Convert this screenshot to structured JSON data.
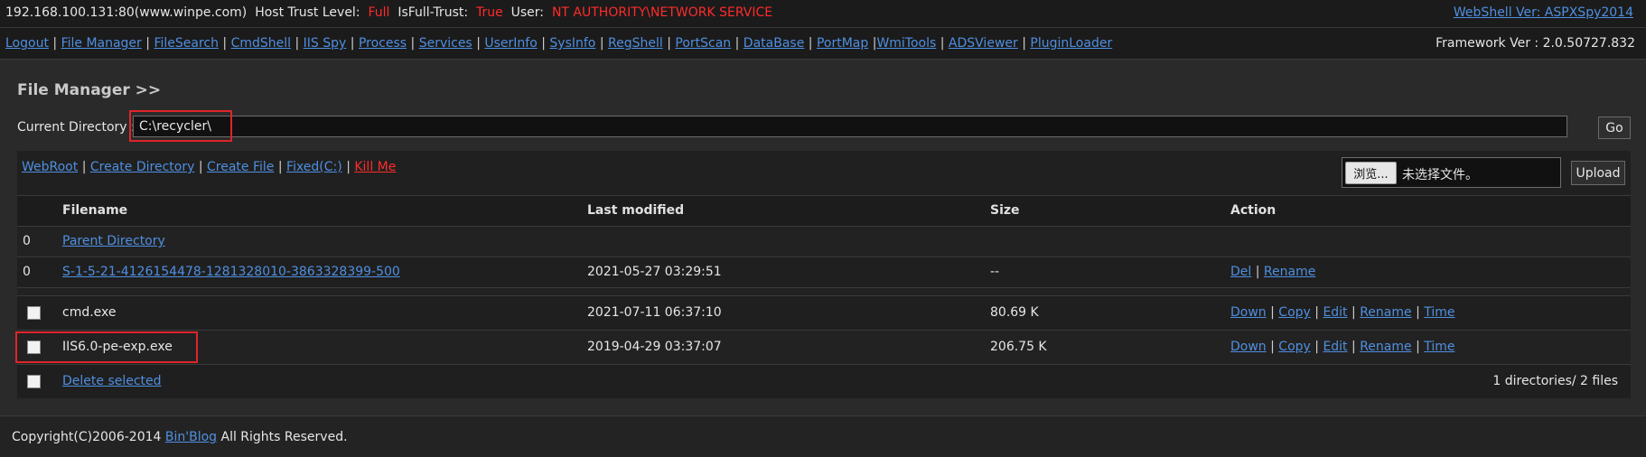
{
  "topbar": {
    "host": "192.168.100.131:80(www.winpe.com)",
    "trust_label": "Host Trust Level:",
    "trust_value": "Full",
    "isfull_label": "IsFull-Trust:",
    "isfull_value": "True",
    "user_label": "User:",
    "user_value": "NT AUTHORITY\\NETWORK SERVICE",
    "version_link": "WebShell Ver: ASPXSpy2014"
  },
  "nav": {
    "items": [
      "Logout",
      "File Manager",
      "FileSearch",
      "CmdShell",
      "IIS Spy",
      "Process",
      "Services",
      "UserInfo",
      "SysInfo",
      "RegShell",
      "PortScan",
      "DataBase",
      "PortMap",
      "WmiTools",
      "ADSViewer",
      "PluginLoader"
    ],
    "framework": "Framework Ver : 2.0.50727.832"
  },
  "file_manager": {
    "title": "File Manager >>",
    "current_dir_label": "Current Directory :",
    "current_dir_value": "C:\\recycler\\",
    "go_label": "Go",
    "actions": [
      "WebRoot",
      "Create Directory",
      "Create File",
      "Fixed(C:)",
      "Kill Me"
    ],
    "browse_label": "浏览...",
    "no_file_text": "未选择文件。",
    "upload_label": "Upload",
    "columns": [
      "Filename",
      "Last modified",
      "Size",
      "Action"
    ],
    "dirs": [
      {
        "num": "0",
        "name": "Parent Directory",
        "modified": "",
        "size": "",
        "actions": []
      },
      {
        "num": "0",
        "name": "S-1-5-21-4126154478-1281328010-3863328399-500",
        "modified": "2021-05-27 03:29:51",
        "size": "--",
        "actions": [
          "Del",
          "Rename"
        ]
      }
    ],
    "files": [
      {
        "name": "cmd.exe",
        "modified": "2021-07-11 06:37:10",
        "size": "80.69 K",
        "actions": [
          "Down",
          "Copy",
          "Edit",
          "Rename",
          "Time"
        ]
      },
      {
        "name": "IIS6.0-pe-exp.exe",
        "modified": "2019-04-29 03:37:07",
        "size": "206.75 K",
        "actions": [
          "Down",
          "Copy",
          "Edit",
          "Rename",
          "Time"
        ]
      }
    ],
    "delete_selected": "Delete selected",
    "summary": "1 directories/ 2 files"
  },
  "footer": {
    "copyright": "Copyright(C)2006-2014",
    "blog_link": "Bin'Blog",
    "rights": "All Rights Reserved."
  },
  "colors": {
    "accent_link": "#4f8fe0",
    "warning_red": "#ff2b2b",
    "highlight_box": "#e0242a"
  }
}
